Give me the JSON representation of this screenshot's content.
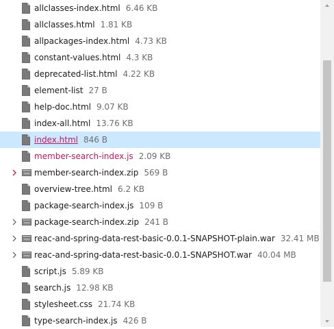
{
  "colors": {
    "selected_background": "#cce8ff",
    "link_text": "#c2185b",
    "size_text": "#6d6d6d",
    "chevron_accent": "#c2185b"
  },
  "files": [
    {
      "name": "allclasses-index.html",
      "size": "6.46 KB",
      "icon": "file-icon",
      "expandable": false
    },
    {
      "name": "allclasses.html",
      "size": "1.81 KB",
      "icon": "file-icon",
      "expandable": false
    },
    {
      "name": "allpackages-index.html",
      "size": "4.73 KB",
      "icon": "file-icon",
      "expandable": false
    },
    {
      "name": "constant-values.html",
      "size": "4.3 KB",
      "icon": "file-icon",
      "expandable": false
    },
    {
      "name": "deprecated-list.html",
      "size": "4.22 KB",
      "icon": "file-icon",
      "expandable": false
    },
    {
      "name": "element-list",
      "size": "27 B",
      "icon": "file-icon",
      "expandable": false
    },
    {
      "name": "help-doc.html",
      "size": "9.07 KB",
      "icon": "file-icon",
      "expandable": false
    },
    {
      "name": "index-all.html",
      "size": "13.76 KB",
      "icon": "file-icon",
      "expandable": false
    },
    {
      "name": "index.html",
      "size": "846 B",
      "icon": "file-icon",
      "expandable": false,
      "selected": true,
      "link": true,
      "underline": true
    },
    {
      "name": "member-search-index.js",
      "size": "2.09 KB",
      "icon": "file-icon",
      "expandable": false,
      "link": true
    },
    {
      "name": "member-search-index.zip",
      "size": "569 B",
      "icon": "archive-icon",
      "expandable": true,
      "chevron_accent": true
    },
    {
      "name": "overview-tree.html",
      "size": "6.2 KB",
      "icon": "file-icon",
      "expandable": false
    },
    {
      "name": "package-search-index.js",
      "size": "109 B",
      "icon": "file-icon",
      "expandable": false
    },
    {
      "name": "package-search-index.zip",
      "size": "241 B",
      "icon": "archive-icon",
      "expandable": true
    },
    {
      "name": "reac-and-spring-data-rest-basic-0.0.1-SNAPSHOT-plain.war",
      "size": "32.41 MB",
      "icon": "archive-icon",
      "expandable": true
    },
    {
      "name": "reac-and-spring-data-rest-basic-0.0.1-SNAPSHOT.war",
      "size": "40.04 MB",
      "icon": "archive-icon",
      "expandable": true
    },
    {
      "name": "script.js",
      "size": "5.89 KB",
      "icon": "file-icon",
      "expandable": false
    },
    {
      "name": "search.js",
      "size": "12.98 KB",
      "icon": "file-icon",
      "expandable": false
    },
    {
      "name": "stylesheet.css",
      "size": "21.74 KB",
      "icon": "file-icon",
      "expandable": false
    },
    {
      "name": "type-search-index.js",
      "size": "426 B",
      "icon": "file-icon",
      "expandable": false
    }
  ]
}
